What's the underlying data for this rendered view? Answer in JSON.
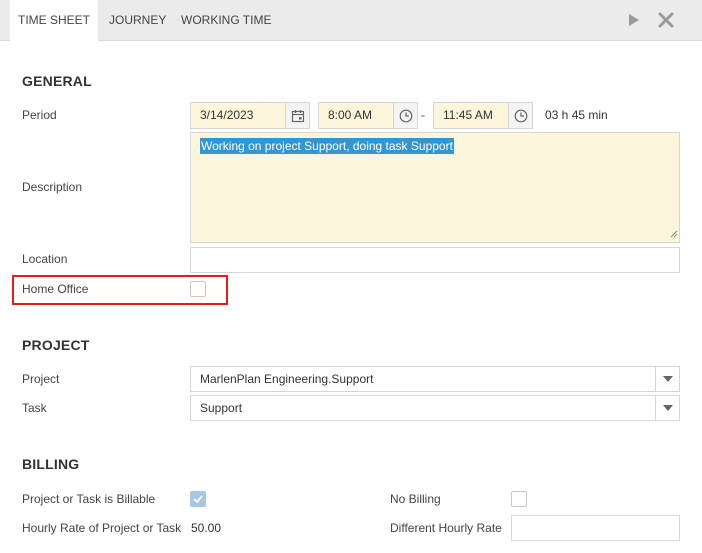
{
  "tabs": [
    {
      "label": "TIME SHEET"
    },
    {
      "label": "JOURNEY"
    },
    {
      "label": "WORKING TIME"
    }
  ],
  "toolbar": {
    "play_icon": "play-icon",
    "close_icon": "close-icon"
  },
  "general": {
    "title": "GENERAL",
    "period_label": "Period",
    "date": "3/14/2023",
    "start_time": "8:00 AM",
    "separator": "-",
    "end_time": "11:45 AM",
    "duration": "03 h 45 min",
    "description_label": "Description",
    "description_value": "Working on project Support, doing task Support",
    "location_label": "Location",
    "location_value": "",
    "home_office_label": "Home Office",
    "home_office_checked": false
  },
  "project": {
    "title": "PROJECT",
    "project_label": "Project",
    "project_value": "MarlenPlan Engineering.Support",
    "task_label": "Task",
    "task_value": "Support"
  },
  "billing": {
    "title": "BILLING",
    "billable_label": "Project or Task is Billable",
    "billable_checked": true,
    "no_billing_label": "No Billing",
    "no_billing_checked": false,
    "hourly_rate_label": "Hourly Rate of Project or Task",
    "hourly_rate_value": "50.00",
    "different_rate_label": "Different Hourly Rate",
    "different_rate_value": ""
  },
  "colors": {
    "accent": "#3296d2",
    "highlight_border": "#e41e1e",
    "input_yellow": "#fdf6dd"
  }
}
